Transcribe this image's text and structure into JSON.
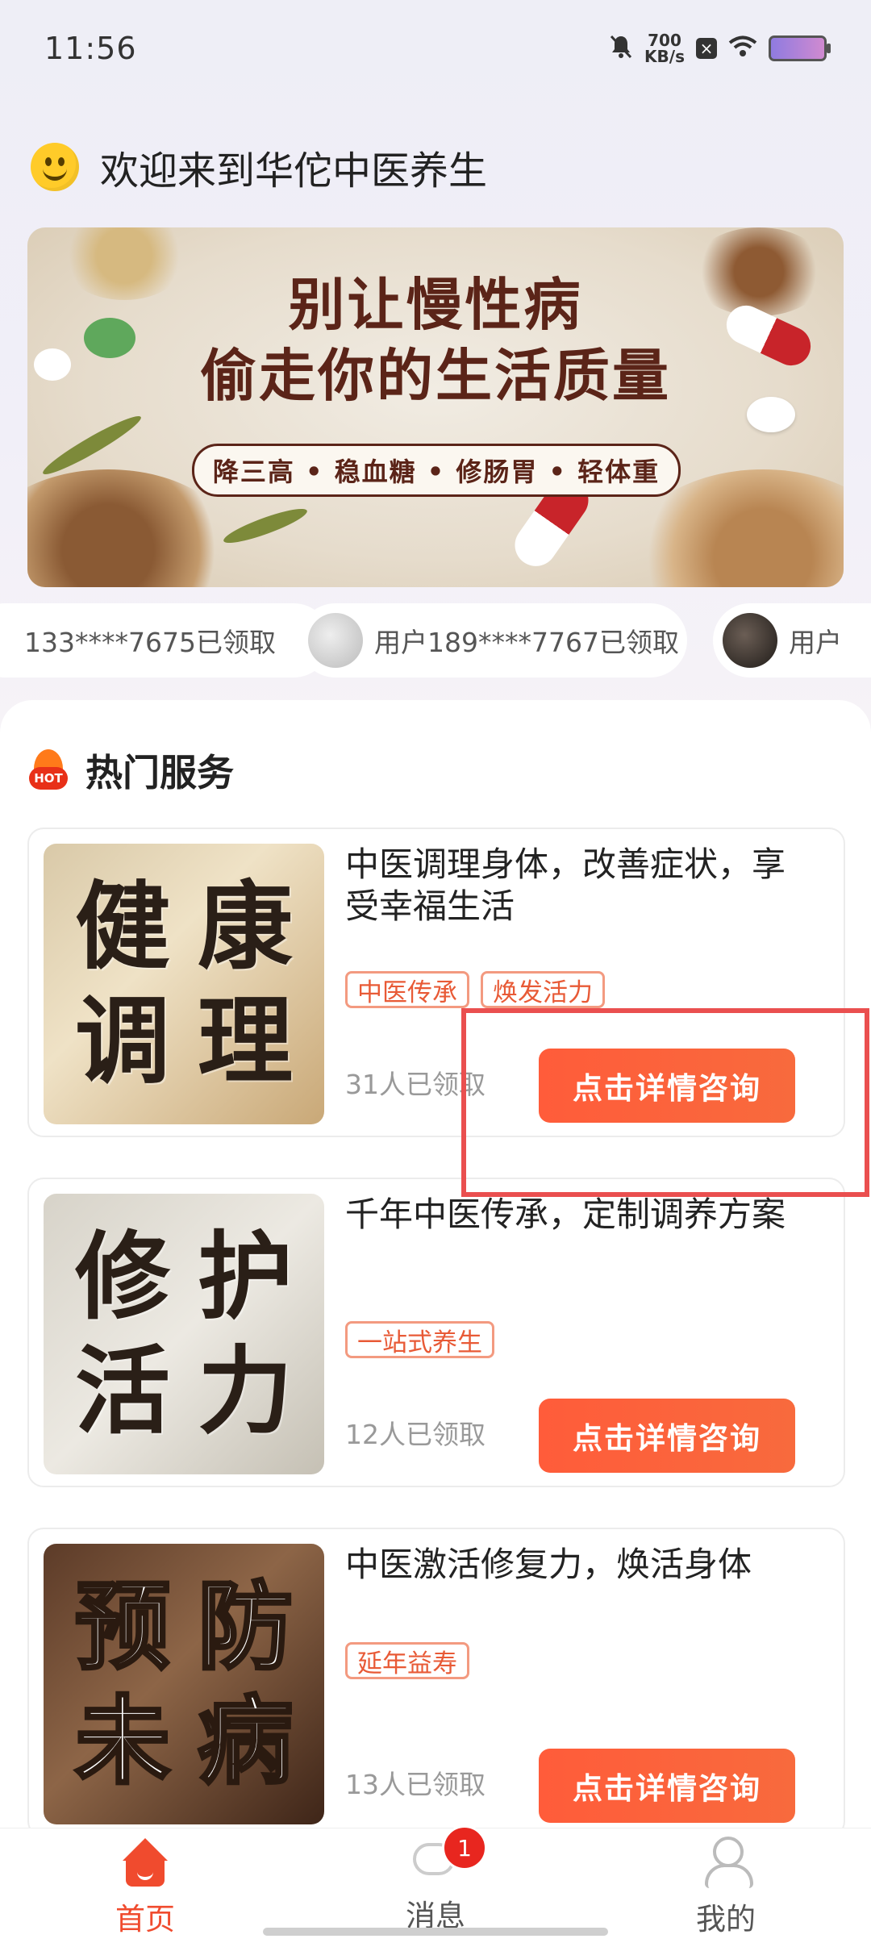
{
  "status_bar": {
    "time": "11:56",
    "net_speed_value": "700",
    "net_speed_unit": "KB/s",
    "icons": [
      "bell-off-icon",
      "close-box-icon",
      "wifi-icon",
      "battery-icon"
    ]
  },
  "welcome": {
    "icon": "smiley-icon",
    "text": "欢迎来到华佗中医养生"
  },
  "banner": {
    "title_line1": "别让慢性病",
    "title_line2": "偷走你的生活质量",
    "subtitle": "降三高 • 稳血糖 • 修肠胃 • 轻体重"
  },
  "ticker": [
    {
      "text": "133****7675已领取"
    },
    {
      "text": "用户189****7767已领取"
    },
    {
      "text": "用户"
    }
  ],
  "section": {
    "icon": "hot-icon",
    "badge": "HOT",
    "title": "热门服务"
  },
  "services": [
    {
      "cover_chars": [
        "健",
        "康",
        "调",
        "理"
      ],
      "title": "中医调理身体，改善症状，享受幸福生活",
      "tags": [
        "中医传承",
        "焕发活力"
      ],
      "count": "31人已领取",
      "cta": "点击详情咨询"
    },
    {
      "cover_chars": [
        "修",
        "护",
        "活",
        "力"
      ],
      "title": "千年中医传承，定制调养方案",
      "tags": [
        "一站式养生"
      ],
      "count": "12人已领取",
      "cta": "点击详情咨询"
    },
    {
      "cover_chars": [
        "预",
        "防",
        "未",
        "病"
      ],
      "title": "中医激活修复力，焕活身体",
      "tags": [
        "延年益寿"
      ],
      "count": "13人已领取",
      "cta": "点击详情咨询"
    }
  ],
  "bottom_nav": {
    "home": "首页",
    "messages": "消息",
    "messages_badge": "1",
    "me": "我的"
  },
  "colors": {
    "accent": "#f04b2e",
    "cta": "#ff5c3a",
    "tag_border": "#f39a80",
    "highlight": "#ea4f4f"
  }
}
